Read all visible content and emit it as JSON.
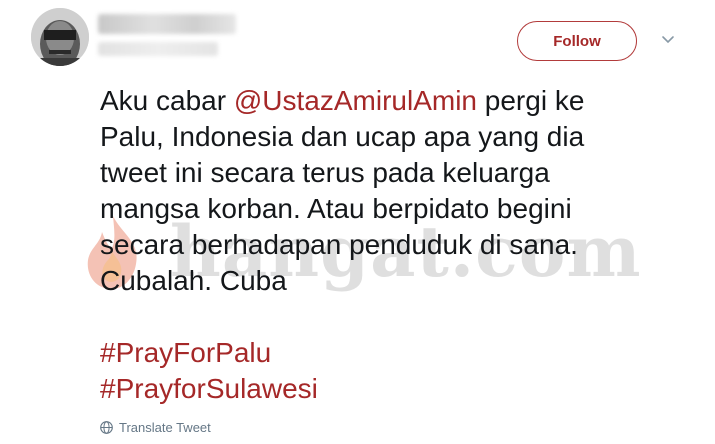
{
  "user": {
    "avatar_icon": "user-avatar",
    "name": "",
    "handle": ""
  },
  "actions": {
    "follow_label": "Follow",
    "more_icon": "chevron-down-icon"
  },
  "tweet": {
    "lines_before": "Aku cabar ",
    "mention": "@UstazAmirulAmin",
    "lines_after_mention": " pergi ke",
    "line2": "Palu, Indonesia dan ucap apa yang dia",
    "line3": "tweet ini secara terus pada keluarga",
    "line4": "mangsa korban. Atau berpidato begini",
    "line5": "secara berhadapan penduduk di sana.",
    "line6": "Cubalah. Cuba",
    "hashtags": [
      "#PrayForPalu",
      "#PrayforSulawesi"
    ]
  },
  "footer": {
    "translate_label": "Translate Tweet",
    "translate_icon": "globe-icon"
  },
  "watermark": {
    "text": "hangat.com",
    "icon": "flame-logo-icon"
  },
  "colors": {
    "accent": "#a52828",
    "text": "#14171a",
    "muted": "#657786"
  }
}
